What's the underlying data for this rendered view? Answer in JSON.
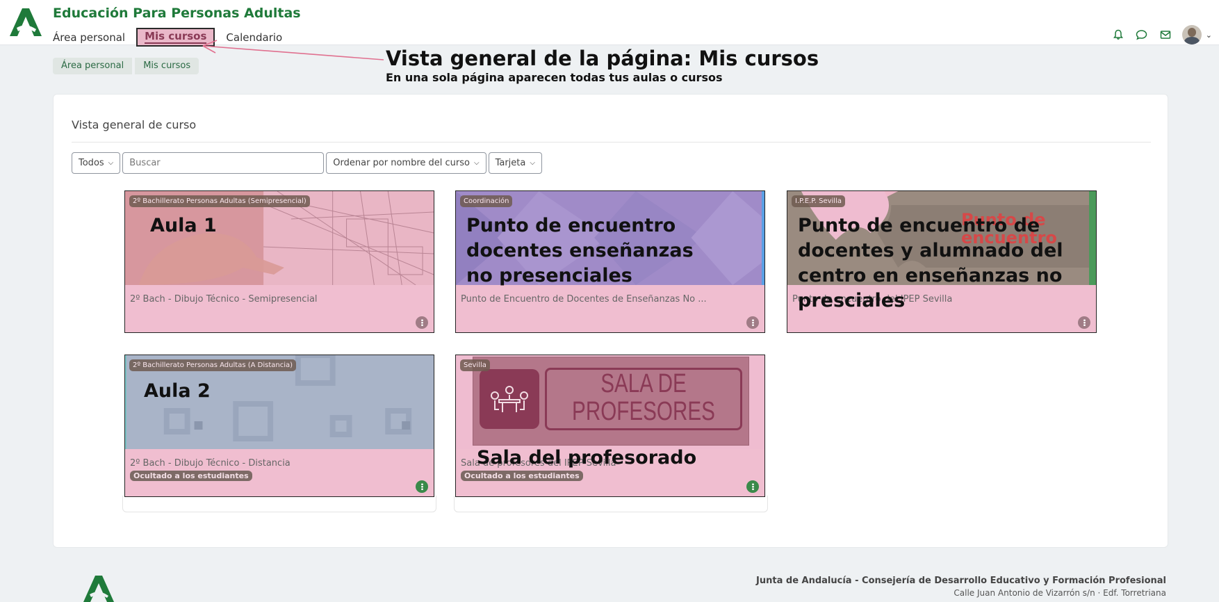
{
  "header": {
    "site_title": "Educación Para Personas Adultas",
    "nav": [
      "Área personal",
      "Mis cursos",
      "Calendario"
    ]
  },
  "breadcrumb": [
    "Área personal",
    "Mis cursos"
  ],
  "annotation": {
    "title": "Vista general de la página: Mis cursos",
    "subtitle": "En una sola página aparecen todas tus aulas o cursos"
  },
  "overview": {
    "title": "Vista general de curso",
    "filter_label": "Todos",
    "search_placeholder": "Buscar",
    "sort_label": "Ordenar por nombre del curso",
    "view_label": "Tarjeta"
  },
  "courses": [
    {
      "category": "2º Bachillerato Personas Adultas (Semipresencial)",
      "label": "Aula 1",
      "name": "2º Bach - Dibujo Técnico - Semipresencial"
    },
    {
      "category": "Coordinación",
      "label": "Punto de encuentro docentes enseñanzas no presenciales",
      "name": "Punto de Encuentro de Docentes de Enseñanzas No ..."
    },
    {
      "category": "I.P.E.P. Sevilla",
      "label": "Punto de encuentro de docentes y alumnado del centro en enseñanzas no presciales",
      "name": "Punto de encuentro del IPEP Sevilla",
      "image_text": "Punto de encuentro"
    },
    {
      "category": "2º Bachillerato Personas Adultas (A Distancia)",
      "label": "Aula 2",
      "name": "2º Bach - Dibujo Técnico - Distancia",
      "badge": "Ocultado a los estudiantes"
    },
    {
      "category": "Sevilla",
      "label": "Sala del profesorado",
      "name": "Sala de profesores del IPEP Sevilla",
      "badge": "Ocultado a los estudiantes",
      "image_text_1": "SALA DE",
      "image_text_2": "PROFESORES"
    }
  ],
  "footer": {
    "line1": "Junta de Andalucía - Consejería de Desarrollo Educativo y Formación Profesional",
    "line2": "Calle Juan Antonio de Vizarrón s/n · Edf. Torretriana"
  },
  "colors": {
    "brand_green": "#1f7a3a",
    "annotation_pink": "#f0bed0",
    "annotation_arrow": "#e0708f"
  },
  "icons": [
    "bell-icon",
    "chat-icon",
    "mail-icon",
    "user-avatar",
    "chevron-down-icon",
    "kebab-menu-icon"
  ]
}
